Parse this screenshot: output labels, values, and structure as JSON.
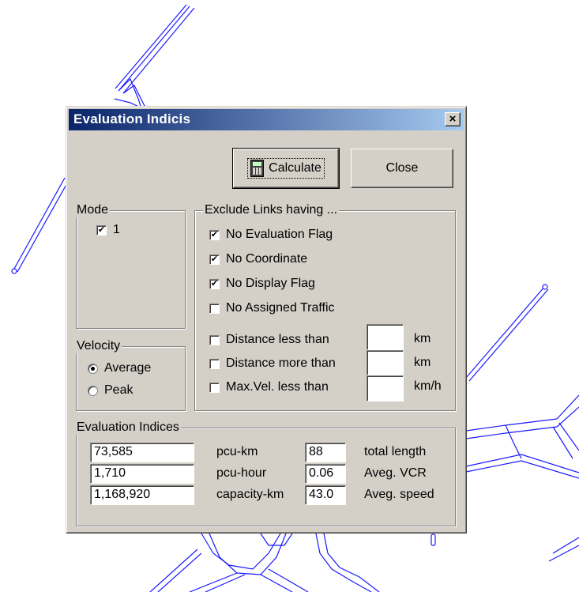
{
  "window": {
    "title": "Evaluation Indicis",
    "close_glyph": "×"
  },
  "buttons": {
    "calculate": "Calculate",
    "close": "Close"
  },
  "mode": {
    "label": "Mode",
    "items": [
      {
        "label": "1",
        "checked": true
      }
    ]
  },
  "velocity": {
    "label": "Velocity",
    "options": [
      {
        "label": "Average",
        "selected": true
      },
      {
        "label": "Peak",
        "selected": false
      }
    ]
  },
  "exclude": {
    "label": "Exclude Links having ...",
    "flags": [
      {
        "label": "No Evaluation Flag",
        "checked": true
      },
      {
        "label": "No Coordinate",
        "checked": true
      },
      {
        "label": "No Display Flag",
        "checked": true
      },
      {
        "label": "No Assigned Traffic",
        "checked": false
      }
    ],
    "thresholds": [
      {
        "label": "Distance less than",
        "checked": false,
        "value": "",
        "unit": "km"
      },
      {
        "label": "Distance more than",
        "checked": false,
        "value": "",
        "unit": "km"
      },
      {
        "label": "Max.Vel. less than",
        "checked": false,
        "value": "",
        "unit": "km/h"
      }
    ]
  },
  "indices": {
    "label": "Evaluation Indices",
    "rows": [
      {
        "value": "73,585",
        "unit": "pcu-km",
        "value2": "88",
        "label2": "total length"
      },
      {
        "value": "1,710",
        "unit": "pcu-hour",
        "value2": "0.06",
        "label2": "Aveg. VCR"
      },
      {
        "value": "1,168,920",
        "unit": "capacity-km",
        "value2": "43.0",
        "label2": "Aveg. speed"
      }
    ]
  },
  "check_glyph": "✔",
  "colors": {
    "dialog_face": "#d4d0c8",
    "title_start": "#0a246a",
    "title_end": "#a6caf0",
    "network_lines": "#1a1aff"
  },
  "icons": {
    "calculate": "calculator-icon",
    "close": "close-icon"
  }
}
